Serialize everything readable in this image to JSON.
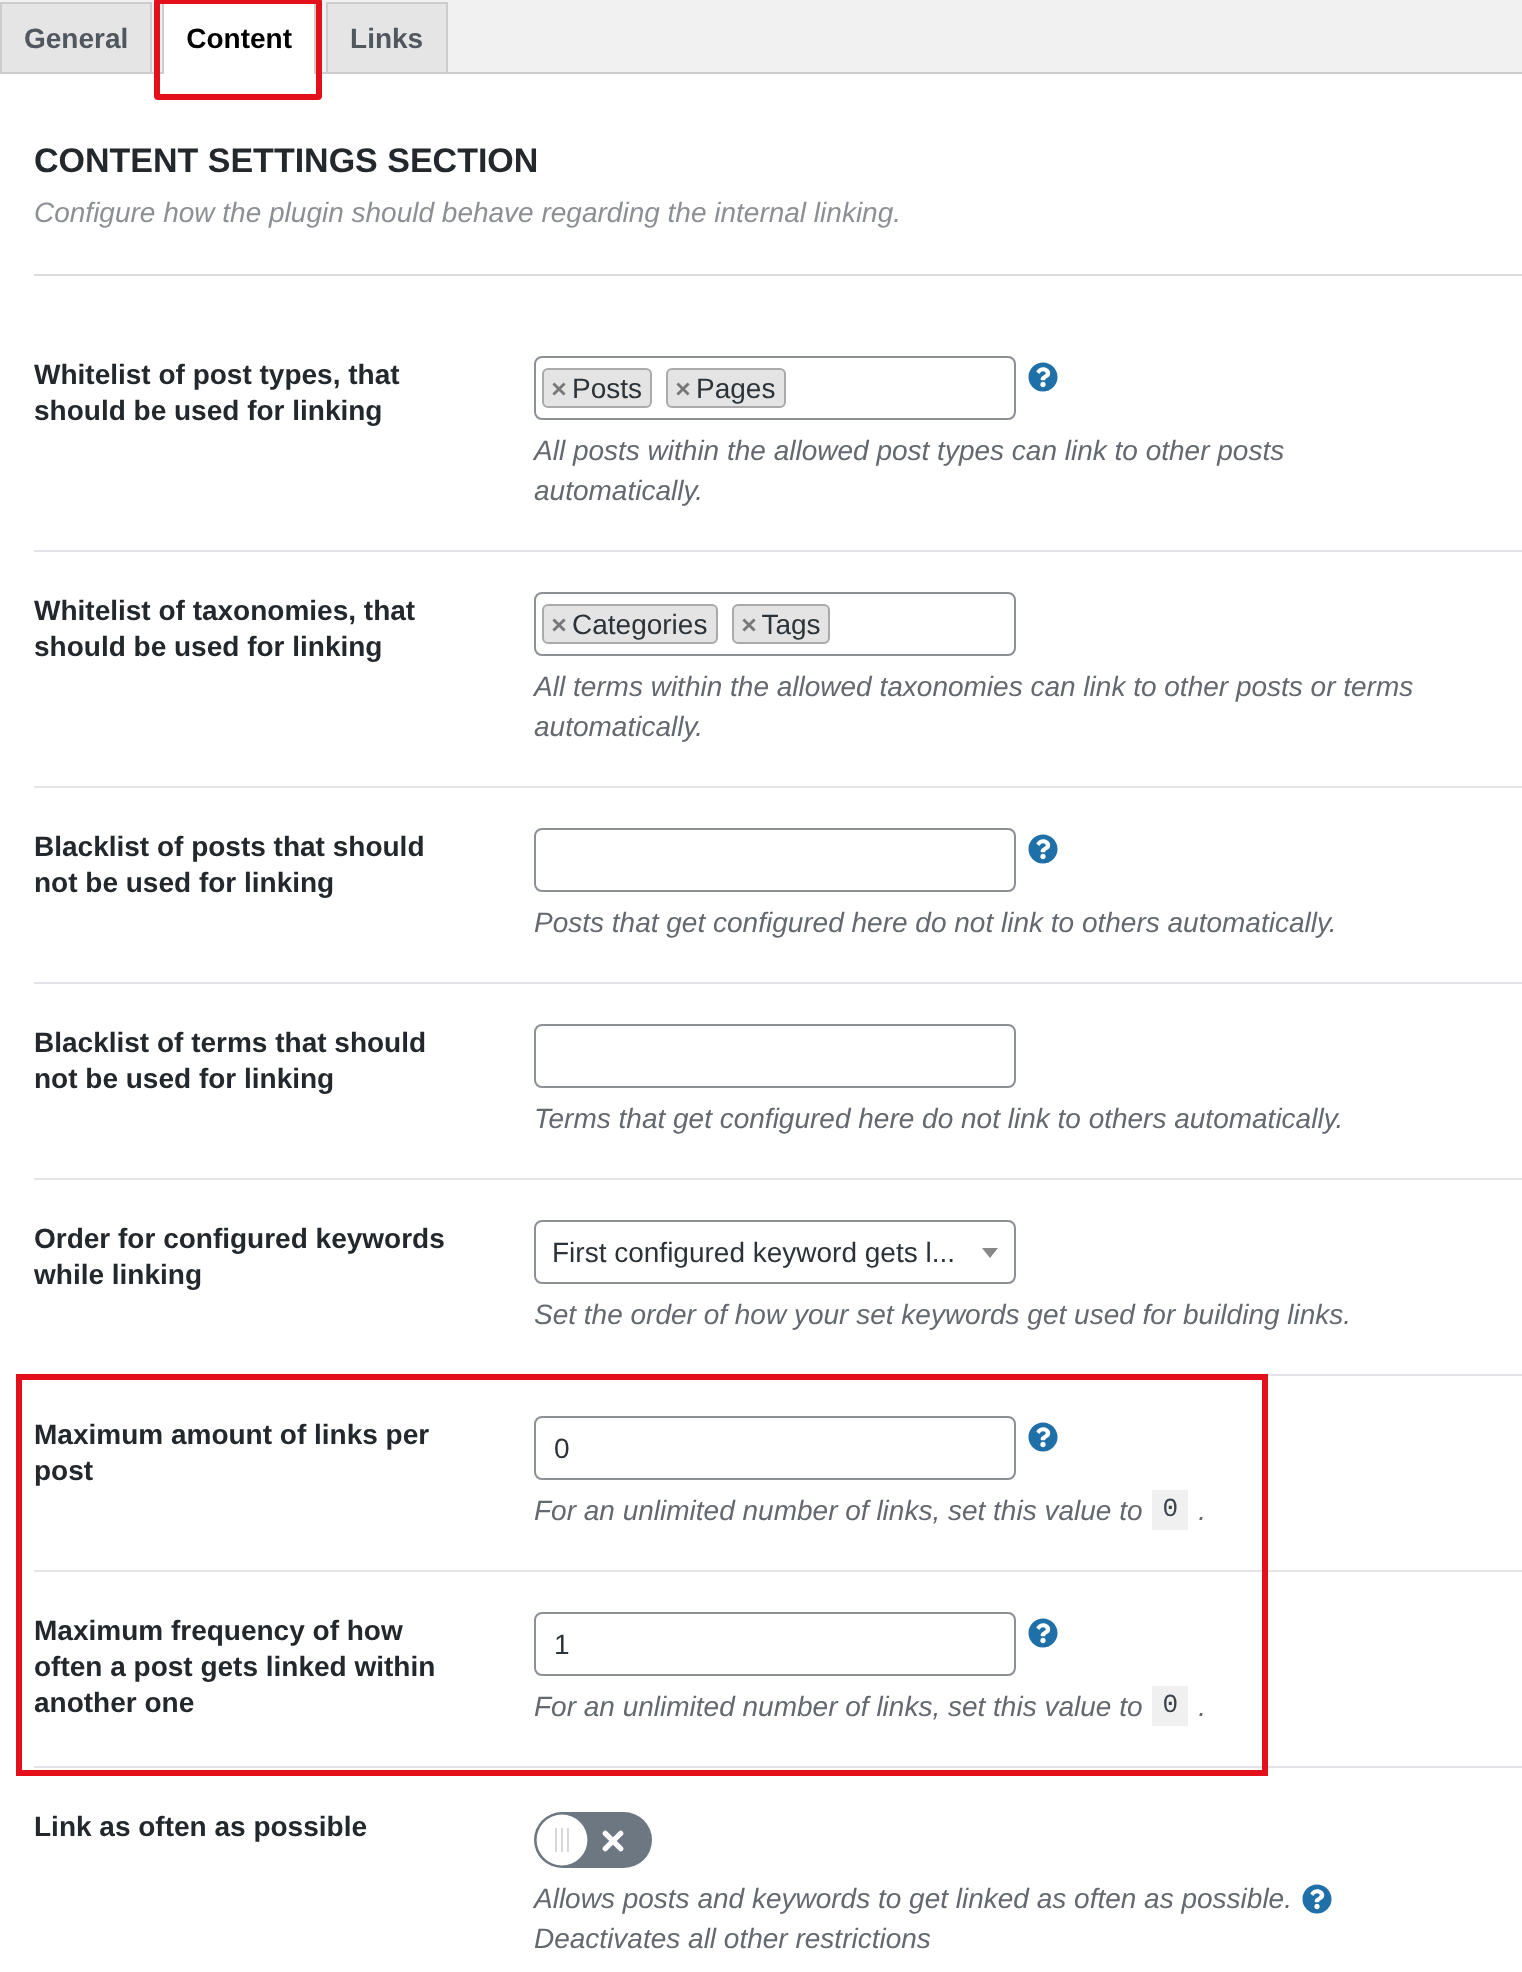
{
  "tabs": [
    {
      "label": "General",
      "selected": false,
      "highlighted": false
    },
    {
      "label": "Content",
      "selected": true,
      "highlighted": true
    },
    {
      "label": "Links",
      "selected": false,
      "highlighted": false
    }
  ],
  "section": {
    "title": "CONTENT SETTINGS SECTION",
    "description": "Configure how the plugin should behave regarding the internal linking."
  },
  "settings": [
    {
      "kind": "tags",
      "label": "Whitelist of post types, that should be used for linking",
      "tags": [
        "Posts",
        "Pages"
      ],
      "help": true,
      "highlighted": false,
      "description": [
        [
          {
            "kind": "text",
            "text": "All posts within the allowed post types can link to other posts automatically."
          }
        ]
      ]
    },
    {
      "kind": "tags",
      "label": "Whitelist of taxonomies, that should be used for linking",
      "tags": [
        "Categories",
        "Tags"
      ],
      "help": false,
      "highlighted": false,
      "description": [
        [
          {
            "kind": "text",
            "text": "All terms within the allowed taxonomies can link to other posts or terms automatically."
          }
        ]
      ]
    },
    {
      "kind": "input",
      "label": "Blacklist of posts that should not be used for linking",
      "help": true,
      "highlighted": false,
      "description": [
        [
          {
            "kind": "text",
            "text": "Posts that get configured here do not link to others automatically."
          }
        ]
      ]
    },
    {
      "kind": "input",
      "label": "Blacklist of terms that should not be used for linking",
      "help": false,
      "highlighted": false,
      "description": [
        [
          {
            "kind": "text",
            "text": "Terms that get configured here do not link to others automatically."
          }
        ]
      ]
    },
    {
      "kind": "select",
      "label": "Order for configured keywords while linking",
      "value": "First configured keyword gets l...",
      "help": false,
      "highlighted": false,
      "description": [
        [
          {
            "kind": "text",
            "text": "Set the order of how your set keywords get used for building links."
          }
        ]
      ]
    },
    {
      "kind": "input",
      "label": "Maximum amount of links per post",
      "value": "0",
      "help": true,
      "highlighted": true,
      "description": [
        [
          {
            "kind": "text",
            "text": "For an unlimited number of links, set this value to"
          },
          {
            "kind": "code",
            "text": "0"
          },
          {
            "kind": "text",
            "text": "."
          }
        ]
      ]
    },
    {
      "kind": "input",
      "label": "Maximum frequency of how often a post gets linked within another one",
      "value": "1",
      "help": true,
      "highlighted": true,
      "description": [
        [
          {
            "kind": "text",
            "text": "For an unlimited number of links, set this value to"
          },
          {
            "kind": "code",
            "text": "0"
          },
          {
            "kind": "text",
            "text": "."
          }
        ]
      ]
    },
    {
      "kind": "toggle",
      "label": "Link as often as possible",
      "on": false,
      "help": true,
      "highlighted": false,
      "description": [
        [
          {
            "kind": "text",
            "text": "Allows posts and keywords to get linked as often as possible."
          }
        ],
        [
          {
            "kind": "text",
            "text": "Deactivates all other restrictions"
          }
        ]
      ]
    }
  ]
}
